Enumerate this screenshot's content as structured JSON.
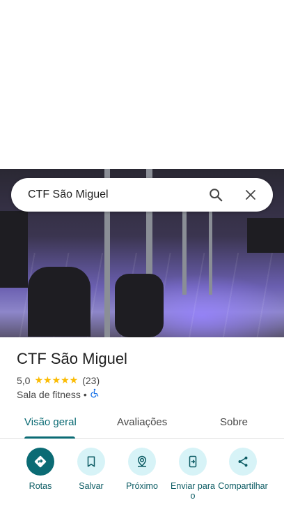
{
  "search": {
    "query": "CTF São Miguel"
  },
  "place": {
    "name": "CTF São Miguel",
    "rating": "5,0",
    "stars": "★★★★★",
    "review_count": "(23)",
    "category": "Sala de fitness",
    "separator": "•"
  },
  "tabs": [
    {
      "label": "Visão geral",
      "active": true
    },
    {
      "label": "Avaliações",
      "active": false
    },
    {
      "label": "Sobre",
      "active": false
    }
  ],
  "actions": [
    {
      "label": "Rotas",
      "icon": "directions-icon"
    },
    {
      "label": "Salvar",
      "icon": "bookmark-icon"
    },
    {
      "label": "Próximo",
      "icon": "nearby-icon"
    },
    {
      "label": "Enviar para o",
      "icon": "send-to-phone-icon"
    },
    {
      "label": "Compartilhar",
      "icon": "share-icon"
    }
  ],
  "colors": {
    "accent": "#0b6b74",
    "action_bg": "#d7f3f7",
    "star": "#fbbc04"
  }
}
